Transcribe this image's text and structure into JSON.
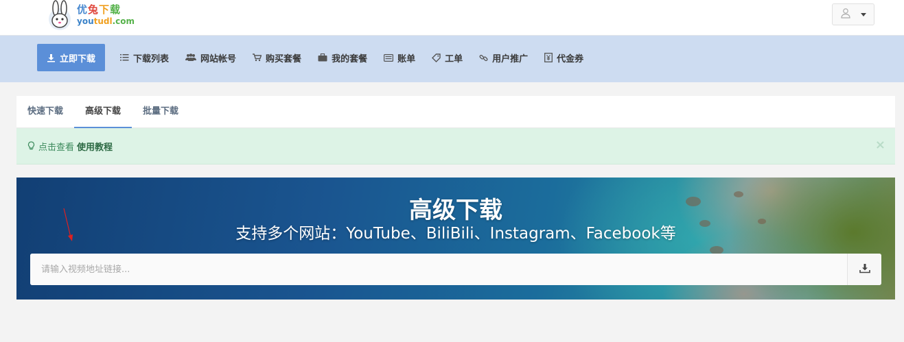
{
  "header": {
    "logo_cn": [
      "优",
      "兔",
      "下",
      "载"
    ],
    "logo_en_a": "you",
    "logo_en_b": "tudl",
    "logo_en_c": ".com"
  },
  "nav": {
    "items": [
      {
        "label": "立即下载",
        "icon": "download-icon"
      },
      {
        "label": "下载列表",
        "icon": "list-icon"
      },
      {
        "label": "网站帐号",
        "icon": "users-icon"
      },
      {
        "label": "购买套餐",
        "icon": "cart-icon"
      },
      {
        "label": "我的套餐",
        "icon": "briefcase-icon"
      },
      {
        "label": "账单",
        "icon": "bill-icon"
      },
      {
        "label": "工单",
        "icon": "ticket-icon"
      },
      {
        "label": "用户推广",
        "icon": "link-icon"
      },
      {
        "label": "代金券",
        "icon": "coupon-icon"
      }
    ]
  },
  "tabs": [
    {
      "label": "快速下载"
    },
    {
      "label": "高级下载"
    },
    {
      "label": "批量下载"
    }
  ],
  "alert": {
    "text": "点击查看",
    "link": "使用教程",
    "close": "×"
  },
  "hero": {
    "title": "高级下载",
    "subtitle": "支持多个网站：YouTube、BiliBili、Instagram、Facebook等",
    "placeholder": "请输入视频地址链接..."
  },
  "colors": {
    "accent": "#5b8fd8",
    "nav_bg": "#cddcf1",
    "alert_bg": "#ddf3e6",
    "arrow": "#e02020"
  }
}
